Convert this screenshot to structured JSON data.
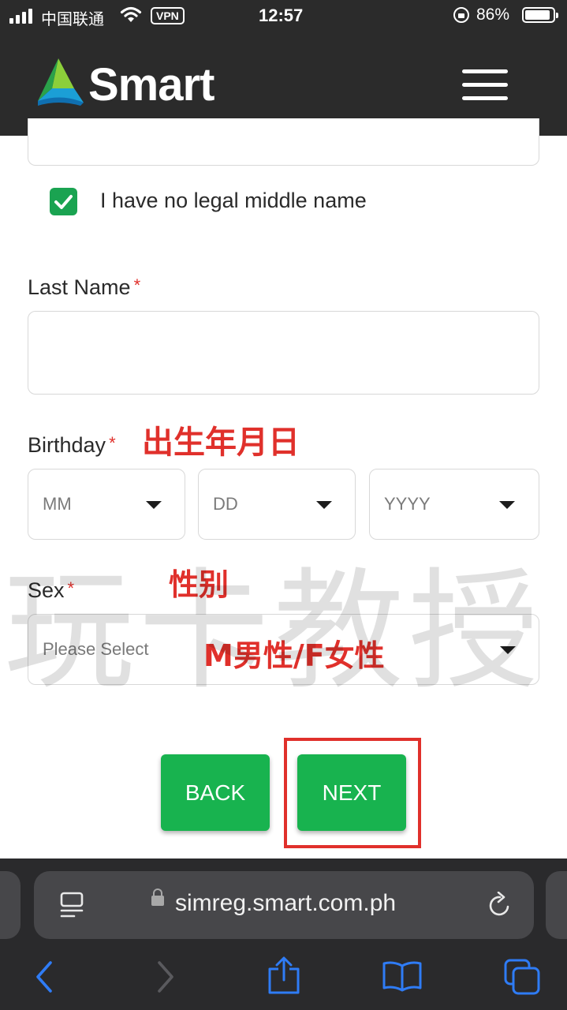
{
  "status_bar": {
    "carrier": "中国联通",
    "vpn": "VPN",
    "time": "12:57",
    "battery": "86%"
  },
  "header": {
    "logo_text": "Smart"
  },
  "form": {
    "no_middle_name_label": "I have no legal middle name",
    "no_middle_name_checked": true,
    "last_name_label": "Last Name",
    "required_mark": "*",
    "birthday_label": "Birthday",
    "birthday_month_placeholder": "MM",
    "birthday_day_placeholder": "DD",
    "birthday_year_placeholder": "YYYY",
    "sex_label": "Sex",
    "sex_placeholder": "Please Select",
    "back_label": "BACK",
    "next_label": "NEXT"
  },
  "annotations": {
    "birthday_note": "出生年月日",
    "sex_note": "性别",
    "sex_options_note": "M男性/F女性",
    "watermark": "玩卡教授"
  },
  "browser": {
    "url": "simreg.smart.com.ph"
  },
  "colors": {
    "accent_green": "#18b34f",
    "annotation_red": "#e0302b",
    "header_bg": "#2b2b2b",
    "ios_blue": "#2f7cf6"
  }
}
